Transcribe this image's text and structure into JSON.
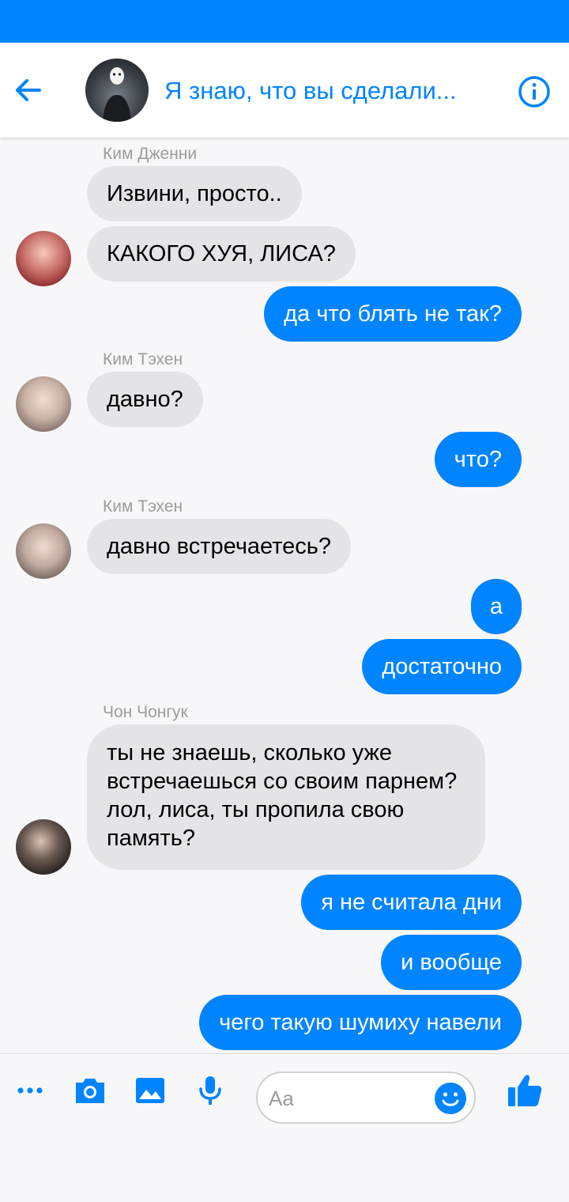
{
  "header": {
    "title": "Я знаю, что вы сделали...",
    "back_icon": "arrow-left-icon",
    "info_icon": "info-icon",
    "accent": "#0084ff"
  },
  "messages": {
    "sender_jennie": "Ким Дженни",
    "jennie_1": "Извини, просто..",
    "jennie_2": "КАКОГО ХУЯ, ЛИСА?",
    "me_1": "да что блять не так?",
    "sender_tae_1": "Ким Тэхен",
    "tae_1": "давно?",
    "me_2": "что?",
    "sender_tae_2": "Ким Тэхен",
    "tae_2": "давно встречаетесь?",
    "me_3": "а",
    "me_4": "достаточно",
    "sender_jk": "Чон Чонгук",
    "jk_1": "ты не знаешь, сколько уже встречаешься со своим парнем? лол, лиса, ты пропила свою память?",
    "me_5": "я не считала дни",
    "me_6": "и вообще",
    "me_7": "чего такую шумиху навели"
  },
  "composer": {
    "placeholder": "Aa",
    "icons": [
      "more-icon",
      "camera-icon",
      "image-icon",
      "microphone-icon",
      "emoji-icon",
      "thumbs-up-icon"
    ]
  }
}
